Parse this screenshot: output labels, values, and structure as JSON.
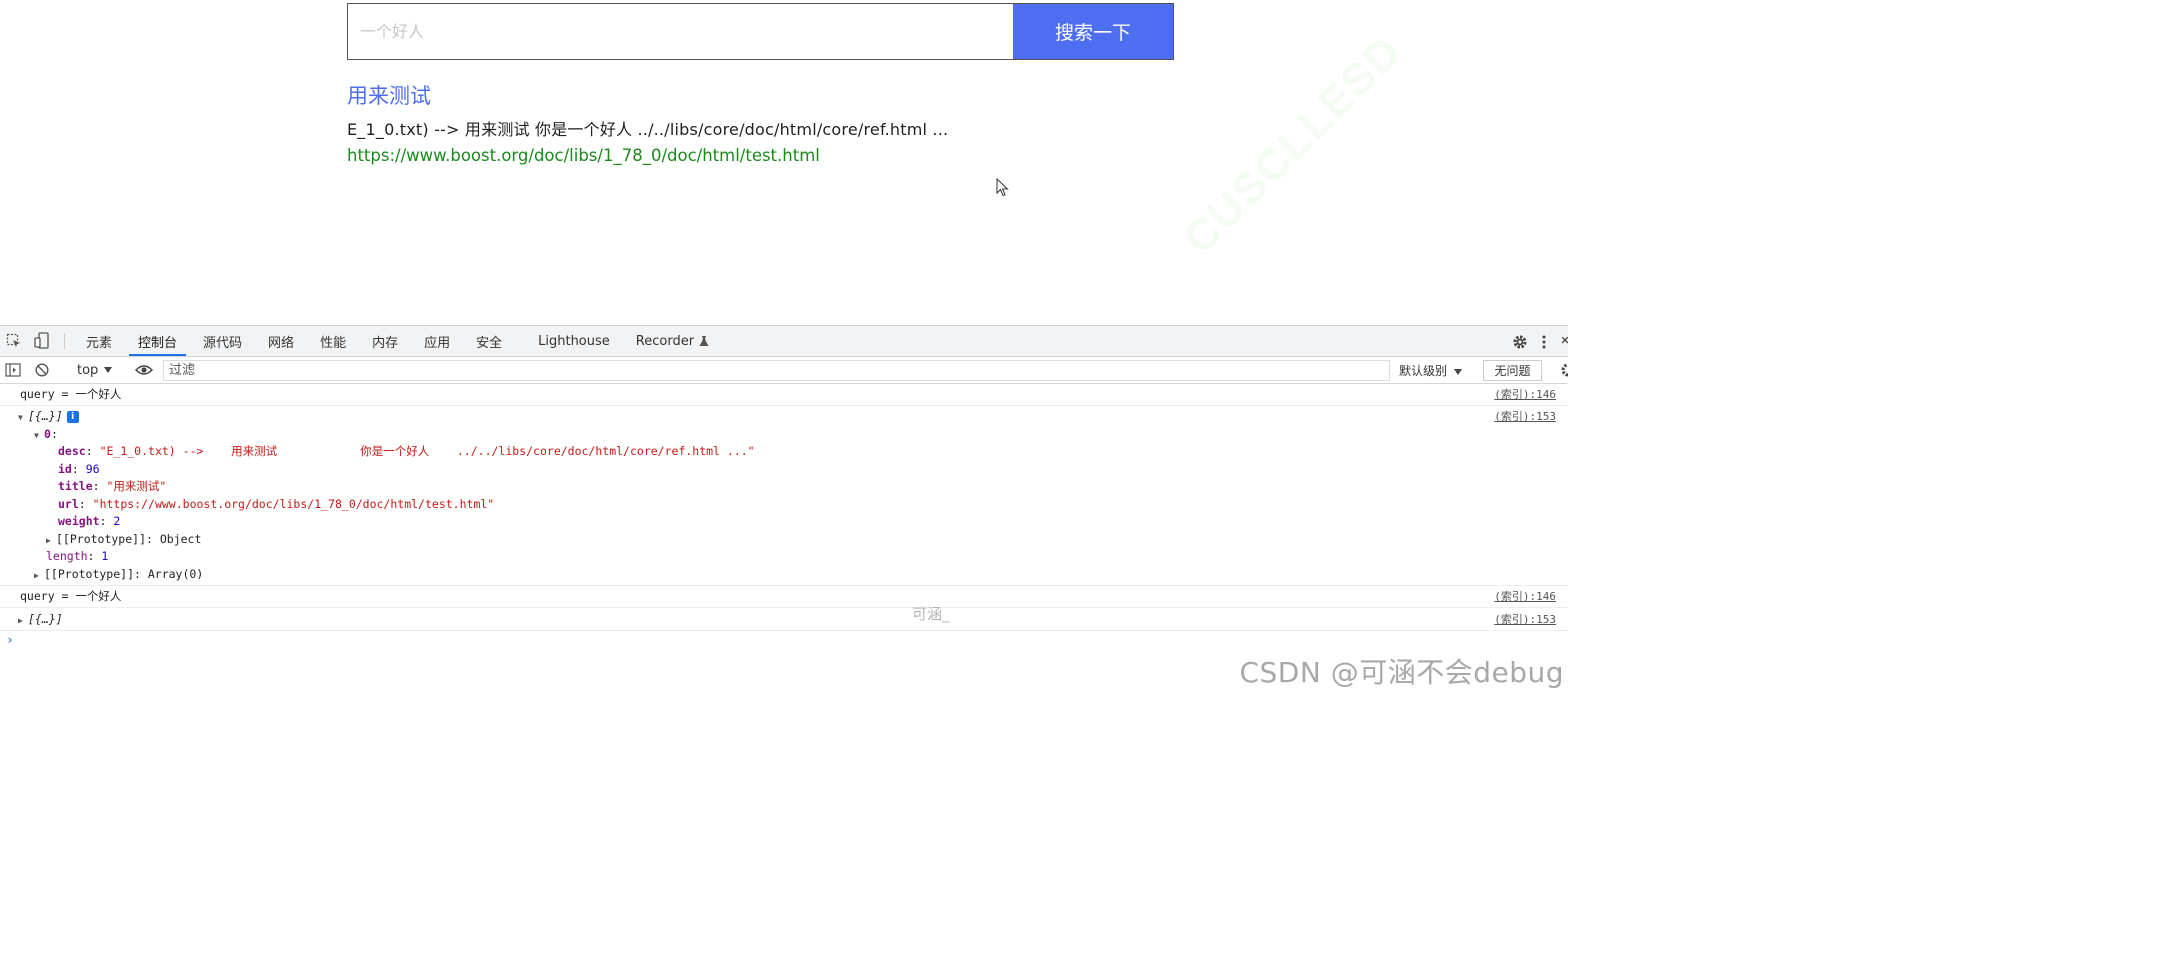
{
  "search": {
    "placeholder": "一个好人",
    "button_label": "搜索一下"
  },
  "result": {
    "title": "用来测试",
    "desc": "E_1_0.txt) --> 用来测试 你是一个好人 ../../libs/core/doc/html/core/ref.html ...",
    "url": "https://www.boost.org/doc/libs/1_78_0/doc/html/test.html"
  },
  "devtools": {
    "tabs": [
      {
        "label": "元素",
        "active": false
      },
      {
        "label": "控制台",
        "active": true
      },
      {
        "label": "源代码",
        "active": false
      },
      {
        "label": "网络",
        "active": false
      },
      {
        "label": "性能",
        "active": false
      },
      {
        "label": "内存",
        "active": false
      },
      {
        "label": "应用",
        "active": false
      },
      {
        "label": "安全",
        "active": false
      },
      {
        "label": "Lighthouse",
        "active": false
      },
      {
        "label": "Recorder",
        "active": false
      }
    ],
    "context": "top",
    "filter_placeholder": "过滤",
    "level": "默认级别",
    "issues": "无问题"
  },
  "console": {
    "log1": {
      "prefix": "query = ",
      "value": "一个好人",
      "source": "(索引):146"
    },
    "obj1": {
      "summary": "[{…}]",
      "source": "(索引):153"
    },
    "index0": "0",
    "desc_key": "desc",
    "desc_val": "\"E_1_0.txt) -->    用来测试            你是一个好人    ../../libs/core/doc/html/core/ref.html ...\"",
    "id_key": "id",
    "id_val": "96",
    "title_key": "title",
    "title_val": "\"用来测试\"",
    "url_key": "url",
    "url_val": "\"https://www.boost.org/doc/libs/1_78_0/doc/html/test.html\"",
    "weight_key": "weight",
    "weight_val": "2",
    "proto_obj": "[[Prototype]]: Object",
    "length_key": "length",
    "length_val": "1",
    "proto_arr": "[[Prototype]]: Array(0)",
    "log2": {
      "prefix": "query = ",
      "value": "一个好人",
      "source": "(索引):146"
    },
    "obj2": {
      "summary": "[{…}]",
      "source": "(索引):153"
    },
    "prompt": "›"
  },
  "watermarks": {
    "center": "可涵_",
    "csdn": "CSDN @可涵不会debug"
  },
  "colors": {
    "accent": "#4e6ef2",
    "url_green": "#1b8a1b",
    "devtools_blue": "#1a73e8",
    "key_purple": "#881280",
    "string_red": "#c41a16",
    "number_blue": "#1c00cf"
  }
}
